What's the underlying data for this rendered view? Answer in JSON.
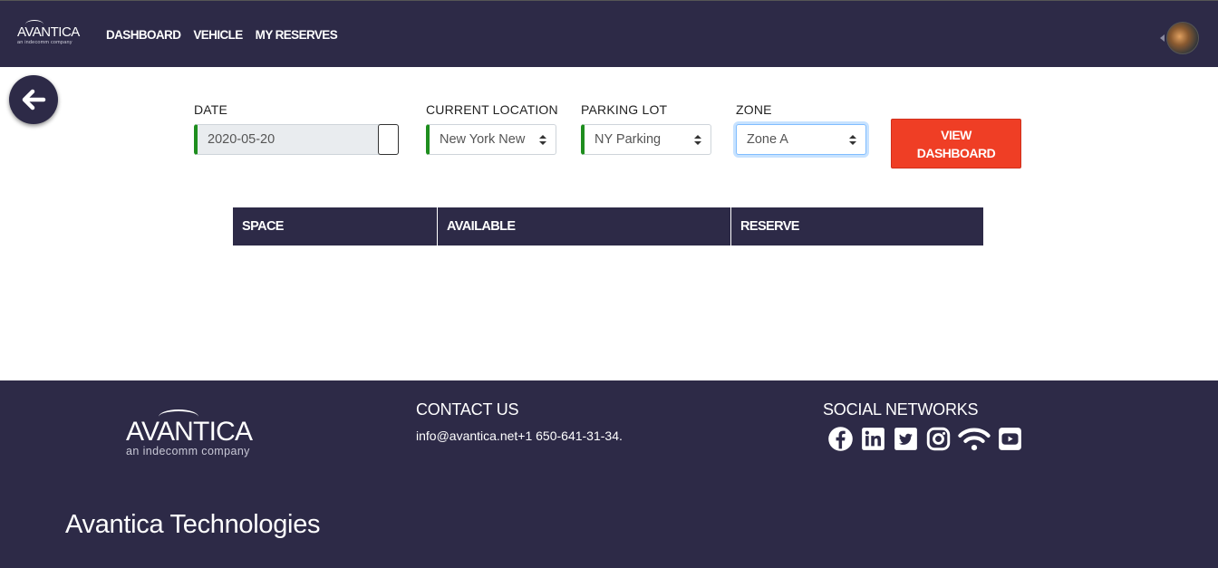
{
  "header": {
    "logo_text": "AVANTICA",
    "logo_tagline": "an indecomm company",
    "nav": [
      "DASHBOARD",
      "VEHICLE",
      "MY RESERVES"
    ]
  },
  "filters": {
    "date": {
      "label": "DATE",
      "value": "2020-05-20"
    },
    "location": {
      "label": "CURRENT LOCATION",
      "value": "New York New"
    },
    "parking_lot": {
      "label": "PARKING LOT",
      "value": "NY Parking"
    },
    "zone": {
      "label": "ZONE",
      "value": "Zone A"
    },
    "view_button": "VIEW DASHBOARD"
  },
  "table": {
    "columns": [
      "SPACE",
      "AVAILABLE",
      "RESERVE"
    ]
  },
  "footer": {
    "logo_text": "AVANTICA",
    "logo_tagline": "an indecomm company",
    "contact_heading": "CONTACT US",
    "contact_text": "info@avantica.net+1 650-641-31-34.",
    "social_heading": "SOCIAL NETWORKS",
    "social_icons": [
      "facebook-icon",
      "linkedin-icon",
      "twitter-icon",
      "instagram-icon",
      "wifi-icon",
      "youtube-icon"
    ],
    "company": "Avantica Technologies"
  },
  "colors": {
    "primary_dark": "#2d2a47",
    "accent_red": "#ef3e25",
    "valid_green": "#1e8e1e"
  }
}
